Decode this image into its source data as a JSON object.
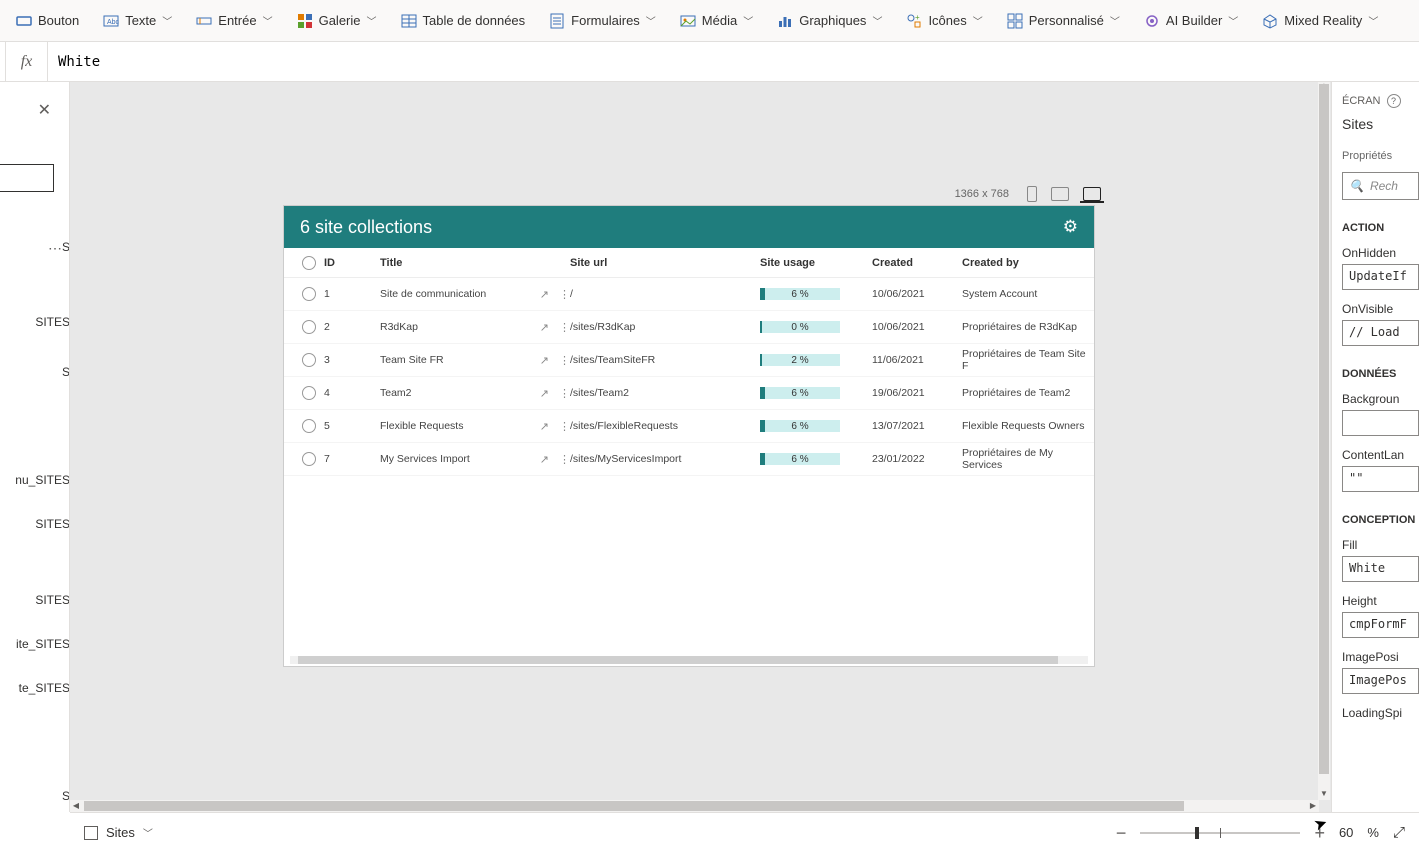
{
  "ribbon": [
    {
      "label": "Bouton",
      "icon": "button-icon",
      "chev": false
    },
    {
      "label": "Texte",
      "icon": "text-icon",
      "chev": true
    },
    {
      "label": "Entrée",
      "icon": "input-icon",
      "chev": true
    },
    {
      "label": "Galerie",
      "icon": "gallery-icon",
      "chev": true
    },
    {
      "label": "Table de données",
      "icon": "datatable-icon",
      "chev": false
    },
    {
      "label": "Formulaires",
      "icon": "form-icon",
      "chev": true
    },
    {
      "label": "Média",
      "icon": "media-icon",
      "chev": true
    },
    {
      "label": "Graphiques",
      "icon": "chart-icon",
      "chev": true
    },
    {
      "label": "Icônes",
      "icon": "icons-icon",
      "chev": true
    },
    {
      "label": "Personnalisé",
      "icon": "custom-icon",
      "chev": true
    },
    {
      "label": "AI Builder",
      "icon": "ai-icon",
      "chev": true
    },
    {
      "label": "Mixed Reality",
      "icon": "mr-icon",
      "chev": true
    }
  ],
  "formula": "White",
  "tree": {
    "items": [
      "S",
      "SITES",
      "S",
      "nu_SITES",
      "SITES",
      "SITES",
      "ite_SITES",
      "te_SITES",
      "S"
    ]
  },
  "device": {
    "dimensions": "1366 x 768"
  },
  "app": {
    "title": "6 site collections",
    "columns": {
      "id": "ID",
      "title": "Title",
      "url": "Site url",
      "usage": "Site usage",
      "created": "Created",
      "by": "Created by"
    },
    "rows": [
      {
        "id": "1",
        "title": "Site de communication",
        "url": "/",
        "usage": 6,
        "usageLabel": "6 %",
        "created": "10/06/2021",
        "by": "System Account"
      },
      {
        "id": "2",
        "title": "R3dKap",
        "url": "/sites/R3dKap",
        "usage": 0,
        "usageLabel": "0 %",
        "created": "10/06/2021",
        "by": "Propriétaires de R3dKap"
      },
      {
        "id": "3",
        "title": "Team Site FR",
        "url": "/sites/TeamSiteFR",
        "usage": 2,
        "usageLabel": "2 %",
        "created": "11/06/2021",
        "by": "Propriétaires de Team Site F"
      },
      {
        "id": "4",
        "title": "Team2",
        "url": "/sites/Team2",
        "usage": 6,
        "usageLabel": "6 %",
        "created": "19/06/2021",
        "by": "Propriétaires de Team2"
      },
      {
        "id": "5",
        "title": "Flexible Requests",
        "url": "/sites/FlexibleRequests",
        "usage": 6,
        "usageLabel": "6 %",
        "created": "13/07/2021",
        "by": "Flexible Requests Owners"
      },
      {
        "id": "7",
        "title": "My Services Import",
        "url": "/sites/MyServicesImport",
        "usage": 6,
        "usageLabel": "6 %",
        "created": "23/01/2022",
        "by": "Propriétaires de My Services"
      }
    ]
  },
  "props": {
    "header": "ÉCRAN",
    "screenName": "Sites",
    "propsLabel": "Propriétés",
    "searchPlaceholder": "Rech",
    "sections": {
      "action": "ACTION",
      "donnees": "DONNÉES",
      "conception": "CONCEPTION"
    },
    "onHidden": {
      "label": "OnHidden",
      "value": "UpdateIf"
    },
    "onVisible": {
      "label": "OnVisible",
      "value": "// Load"
    },
    "background": {
      "label": "Backgroun"
    },
    "contentLan": {
      "label": "ContentLan",
      "value": "\"\""
    },
    "fill": {
      "label": "Fill",
      "value": "White"
    },
    "height": {
      "label": "Height",
      "value": "cmpFormF"
    },
    "imagePos": {
      "label": "ImagePosi",
      "value": "ImagePos"
    },
    "loadingSpi": {
      "label": "LoadingSpi"
    }
  },
  "status": {
    "screen": "Sites",
    "zoom": "60",
    "zoomUnit": "%"
  }
}
